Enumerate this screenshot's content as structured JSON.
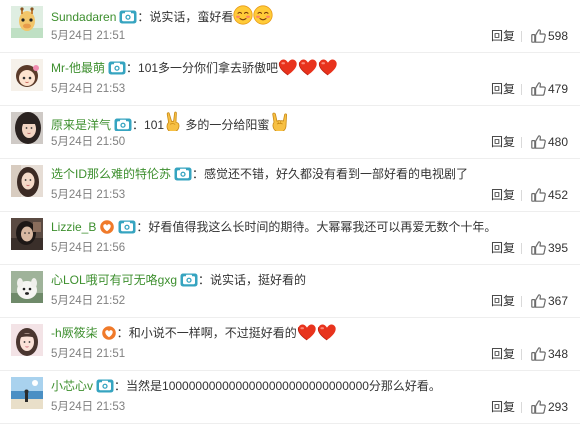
{
  "reply_label": "回复",
  "accent_colors": {
    "username": "#3d8f2e",
    "vip_badge": "#36a4c0",
    "time": "#808080",
    "heart": "#e8331d"
  },
  "comments": [
    {
      "user": "Sundadaren",
      "badges": [
        "vip-camera-icon"
      ],
      "separator": "：",
      "text": "说实话，蛮好看",
      "emoji_after": [
        "blush-emoji",
        "blush-emoji"
      ],
      "time": "5月24日 21:51",
      "likes": "598"
    },
    {
      "user": "Mr-他最萌",
      "badges": [
        "vip-camera-icon"
      ],
      "separator": "：",
      "text": "101多一分你们拿去骄傲吧",
      "emoji_after": [
        "heart-emoji",
        "heart-emoji",
        "heart-emoji"
      ],
      "time": "5月24日 21:53",
      "likes": "479"
    },
    {
      "user": "原来是洋气",
      "badges": [
        "vip-camera-icon"
      ],
      "separator": "：",
      "text_before": "101",
      "emoji_mid": "victory-hand-emoji",
      "text_after": " 多的一分给阳蜜",
      "emoji_after": [
        "rock-hand-emoji"
      ],
      "time": "5月24日 21:50",
      "likes": "480"
    },
    {
      "user": "选个ID那么难的特伦苏",
      "badges": [
        "vip-camera-icon"
      ],
      "separator": "：",
      "text": "感觉还不错，好久都没有看到一部好看的电视剧了",
      "emoji_after": [],
      "time": "5月24日 21:53",
      "likes": "452"
    },
    {
      "user": "Lizzie_B",
      "badges": [
        "fan-heart-badge-icon",
        "vip-camera-icon"
      ],
      "separator": "：",
      "text": "好看值得我这么长时间的期待。大幂幂我还可以再爱无数个十年。",
      "emoji_after": [],
      "time": "5月24日 21:56",
      "likes": "395"
    },
    {
      "user": "心LOL哦可有可无咯gxg",
      "badges": [
        "vip-camera-icon"
      ],
      "separator": "：",
      "text": "说实话，挺好看的",
      "emoji_after": [],
      "time": "5月24日 21:52",
      "likes": "367"
    },
    {
      "user": "-h厥筱柒",
      "badges": [
        "fan-heart-badge-icon"
      ],
      "separator": "：",
      "text": "和小说不一样啊，不过挺好看的",
      "emoji_after": [
        "heart-emoji",
        "heart-emoji"
      ],
      "time": "5月24日 21:51",
      "likes": "348"
    },
    {
      "user": "小芯心v",
      "badges": [
        "vip-camera-icon"
      ],
      "separator": "：",
      "text": "当然是1000000000000000000000000000000分那么好看。",
      "emoji_after": [],
      "time": "5月24日 21:53",
      "likes": "293"
    }
  ]
}
